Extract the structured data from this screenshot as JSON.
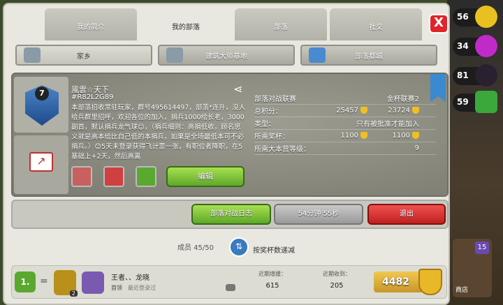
{
  "tabs": [
    "我的简介",
    "我的部落",
    "部落",
    "社交"
  ],
  "close_label": "X",
  "subtabs": [
    "家乡",
    "建筑大师基地",
    "部落都城"
  ],
  "clan": {
    "level": "7",
    "name": "風雲☆天下",
    "tag": "#R82L2G89",
    "description": "本部落招收常驻玩家，群号495614497，部落*连升，没人给兵群里招呼，欢迎各位的加入，捐兵1000给长老，3000副首，默认捐兵龙气球😊，（捐兵细则：高捐低收，顾名思义就是高本给比自己低的本捐兵，如果是全场最低本可不必捐兵。）😊5天未登录获得飞计票一张，有职位者降职，在5基础上+2天，然后高离",
    "edit_label": "编辑"
  },
  "stats": {
    "war_league_label": "部落对战联赛",
    "league": "金杯联赛2",
    "rows": [
      {
        "k": "总积分：",
        "v1": "25457",
        "v2": "23724"
      },
      {
        "k": "类型：",
        "v1": "",
        "v2": "只有被批准才能加入"
      },
      {
        "k": "所需奖杯：",
        "v1": "1100",
        "v2": "1100"
      },
      {
        "k": "所需大本营等级：",
        "v1": "",
        "v2": "9"
      }
    ]
  },
  "actions": {
    "war_log": "部落对战日志",
    "timer": "54分钟 55秒",
    "leave": "退出"
  },
  "members": {
    "label": "成员 45/50",
    "sort": "按奖杯数递减"
  },
  "member": {
    "rank": "1.",
    "eq": "=",
    "townhall": "2",
    "name": "王者、、龙晓",
    "role": "首领",
    "last": "最近登录过",
    "donated_label": "近期增援：",
    "donated": "615",
    "received_label": "近期收到：",
    "received": "205",
    "trophies": "4482"
  },
  "side": {
    "res1": "56",
    "res2": "34",
    "res3": "81",
    "res4": "59",
    "shop_badge": "15",
    "shop_label": "商店"
  }
}
